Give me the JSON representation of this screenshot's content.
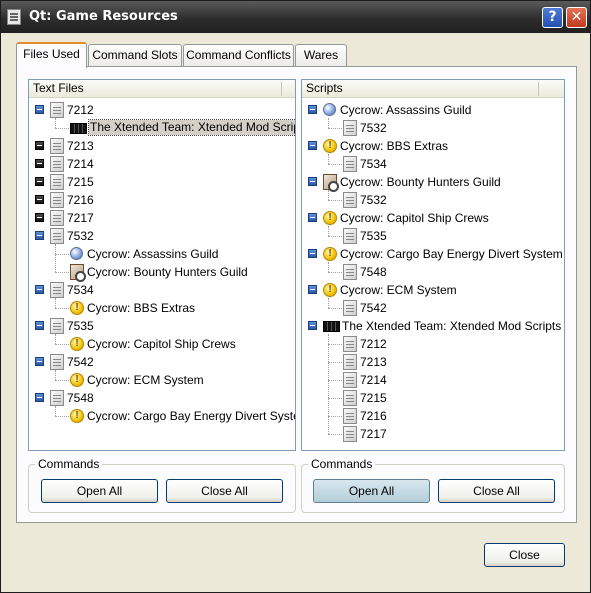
{
  "window": {
    "title": "Qt: Game Resources",
    "help_label": "?",
    "close_label": "✕"
  },
  "tabs": [
    {
      "label": "Files Used",
      "active": true
    },
    {
      "label": "Command Slots",
      "active": false
    },
    {
      "label": "Command Conflicts",
      "active": false
    },
    {
      "label": "Wares",
      "active": false
    }
  ],
  "text_files": {
    "header": "Text Files",
    "nodes": [
      {
        "label": "7212",
        "icon": "document-icon",
        "expanded": true
      },
      {
        "label": "The Xtended Team: Xtended Mod Scripts",
        "icon": "xtended-icon",
        "selected": true
      },
      {
        "label": "7213",
        "icon": "document-icon",
        "expanded": false
      },
      {
        "label": "7214",
        "icon": "document-icon",
        "expanded": false
      },
      {
        "label": "7215",
        "icon": "document-icon",
        "expanded": false
      },
      {
        "label": "7216",
        "icon": "document-icon",
        "expanded": false
      },
      {
        "label": "7217",
        "icon": "document-icon",
        "expanded": false
      },
      {
        "label": "7532",
        "icon": "document-icon",
        "expanded": true
      },
      {
        "label": "Cycrow: Assassins Guild",
        "icon": "globe-icon"
      },
      {
        "label": "Cycrow: Bounty Hunters Guild",
        "icon": "bounty-icon"
      },
      {
        "label": "7534",
        "icon": "document-icon",
        "expanded": true
      },
      {
        "label": "Cycrow: BBS Extras",
        "icon": "info-icon"
      },
      {
        "label": "7535",
        "icon": "document-icon",
        "expanded": true
      },
      {
        "label": "Cycrow: Capitol Ship Crews",
        "icon": "info-icon"
      },
      {
        "label": "7542",
        "icon": "document-icon",
        "expanded": true
      },
      {
        "label": "Cycrow: ECM System",
        "icon": "info-icon"
      },
      {
        "label": "7548",
        "icon": "document-icon",
        "expanded": true
      },
      {
        "label": "Cycrow: Cargo Bay Energy Divert System",
        "icon": "info-icon"
      }
    ]
  },
  "scripts": {
    "header": "Scripts",
    "nodes": [
      {
        "label": "Cycrow: Assassins Guild",
        "icon": "globe-icon",
        "expanded": true
      },
      {
        "label": "7532",
        "icon": "document-icon"
      },
      {
        "label": "Cycrow: BBS Extras",
        "icon": "info-icon",
        "expanded": true
      },
      {
        "label": "7534",
        "icon": "document-icon"
      },
      {
        "label": "Cycrow: Bounty Hunters Guild",
        "icon": "bounty-icon",
        "expanded": true
      },
      {
        "label": "7532",
        "icon": "document-icon"
      },
      {
        "label": "Cycrow: Capitol Ship Crews",
        "icon": "info-icon",
        "expanded": true
      },
      {
        "label": "7535",
        "icon": "document-icon"
      },
      {
        "label": "Cycrow: Cargo Bay Energy Divert System",
        "icon": "info-icon",
        "expanded": true
      },
      {
        "label": "7548",
        "icon": "document-icon"
      },
      {
        "label": "Cycrow: ECM System",
        "icon": "info-icon",
        "expanded": true
      },
      {
        "label": "7542",
        "icon": "document-icon"
      },
      {
        "label": "The Xtended Team: Xtended Mod Scripts",
        "icon": "xtended-icon",
        "expanded": true
      },
      {
        "label": "7212",
        "icon": "document-icon"
      },
      {
        "label": "7213",
        "icon": "document-icon"
      },
      {
        "label": "7214",
        "icon": "document-icon"
      },
      {
        "label": "7215",
        "icon": "document-icon"
      },
      {
        "label": "7216",
        "icon": "document-icon"
      },
      {
        "label": "7217",
        "icon": "document-icon"
      }
    ]
  },
  "commands_left": {
    "title": "Commands",
    "open_all": "Open All",
    "close_all": "Close All"
  },
  "commands_right": {
    "title": "Commands",
    "open_all": "Open All",
    "close_all": "Close All"
  },
  "footer": {
    "close_label": "Close"
  }
}
